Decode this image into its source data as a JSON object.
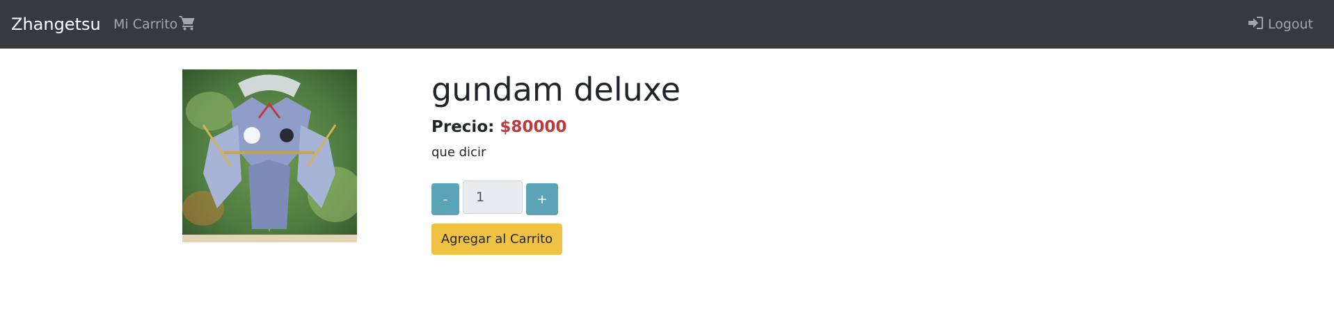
{
  "navbar": {
    "brand": "Zhangetsu",
    "cart_label": "Mi Carrito",
    "cart_icon": "shopping-cart-icon",
    "logout_label": "Logout",
    "logout_icon": "sign-in-icon",
    "background": "#343a40"
  },
  "product": {
    "title": "gundam deluxe",
    "price_label": "Precio:",
    "price_value": "$80000",
    "description": "que dicir",
    "quantity": "1",
    "decrement_label": "-",
    "increment_label": "+",
    "add_to_cart_label": "Agregar al Carrito",
    "price_color": "#c0393c",
    "info_button_color": "#5ba4b7",
    "add_button_color": "#f0c244"
  }
}
